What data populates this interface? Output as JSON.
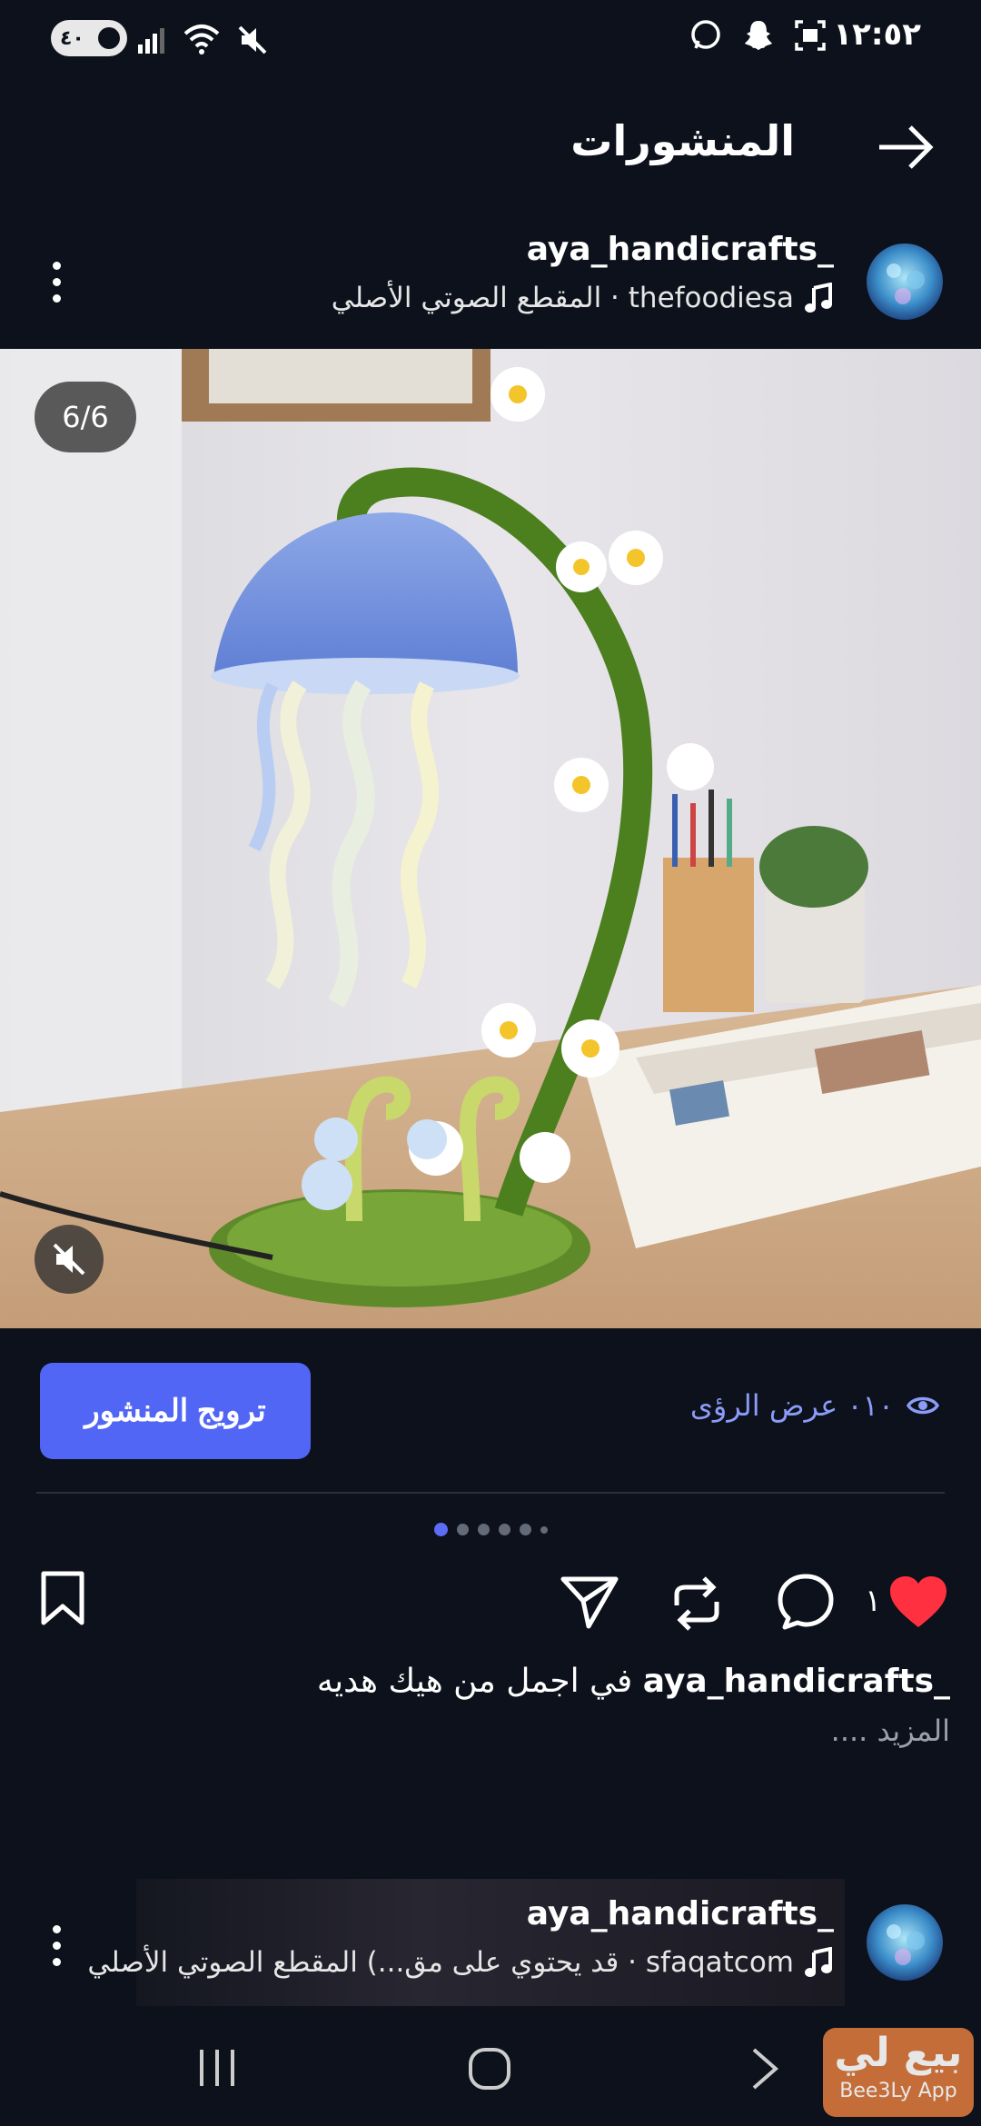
{
  "status_bar": {
    "time": "١٢:٥٢",
    "battery": "٤٠",
    "icons": [
      "whatsapp-icon",
      "snapchat-icon",
      "screenshot-icon",
      "mute-icon",
      "wifi-icon",
      "signal-icon"
    ]
  },
  "header": {
    "title": "المنشورات",
    "back_icon": "arrow-right-icon"
  },
  "post": {
    "username": "aya_handicrafts_",
    "audio": "المقطع الصوتي الأصلي · thefoodiesa",
    "counter": "6/6",
    "promote_label": "ترويج المنشور",
    "views": "٠١٠ عرض الرؤى",
    "like_count": "١",
    "caption_user": "aya_handicrafts_",
    "caption_text": "في اجمل من هيك هديه",
    "more": ".... المزيد",
    "dots_total": 6,
    "dots_active": 0
  },
  "post2": {
    "username": "aya_handicrafts_",
    "audio": "قد يحتوي على مق...) المقطع الصوتي الأصلي · sfaqatcom"
  },
  "watermark": {
    "line1": "بيع لي",
    "line2": "Bee3Ly App"
  },
  "colors": {
    "background": "#0c111b",
    "accent": "#5266f5",
    "like": "#ff3040",
    "views": "#8c9bf8"
  }
}
